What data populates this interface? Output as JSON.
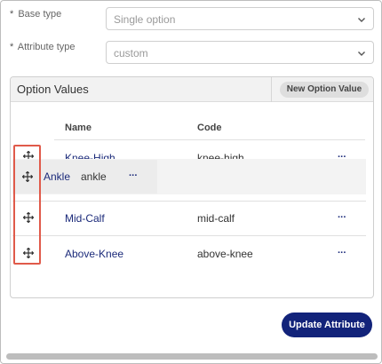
{
  "form": {
    "base_type": {
      "label": "Base type",
      "required_mark": "*",
      "value": "Single option"
    },
    "attribute_type": {
      "label": "Attribute type",
      "required_mark": "*",
      "value": "custom"
    }
  },
  "option_values": {
    "title": "Option Values",
    "new_button_label": "New Option Value",
    "columns": {
      "name": "Name",
      "code": "Code"
    },
    "rows": [
      {
        "name": "Knee-High",
        "code": "knee-high",
        "more": "···"
      },
      {
        "name": "Mid-Calf",
        "code": "mid-calf",
        "more": "···"
      },
      {
        "name": "Above-Knee",
        "code": "above-knee",
        "more": "···"
      }
    ],
    "dragging_row": {
      "name": "Ankle",
      "code": "ankle",
      "more": "···"
    }
  },
  "actions": {
    "update_label": "Update Attribute"
  },
  "colors": {
    "accent": "#12237a",
    "link": "#1b2a7a",
    "highlight": "#e05a4a"
  },
  "icons": {
    "select_chevron": "chevron-down-icon",
    "drag_handle": "drag-move-icon",
    "more": "more-horizontal-icon"
  }
}
